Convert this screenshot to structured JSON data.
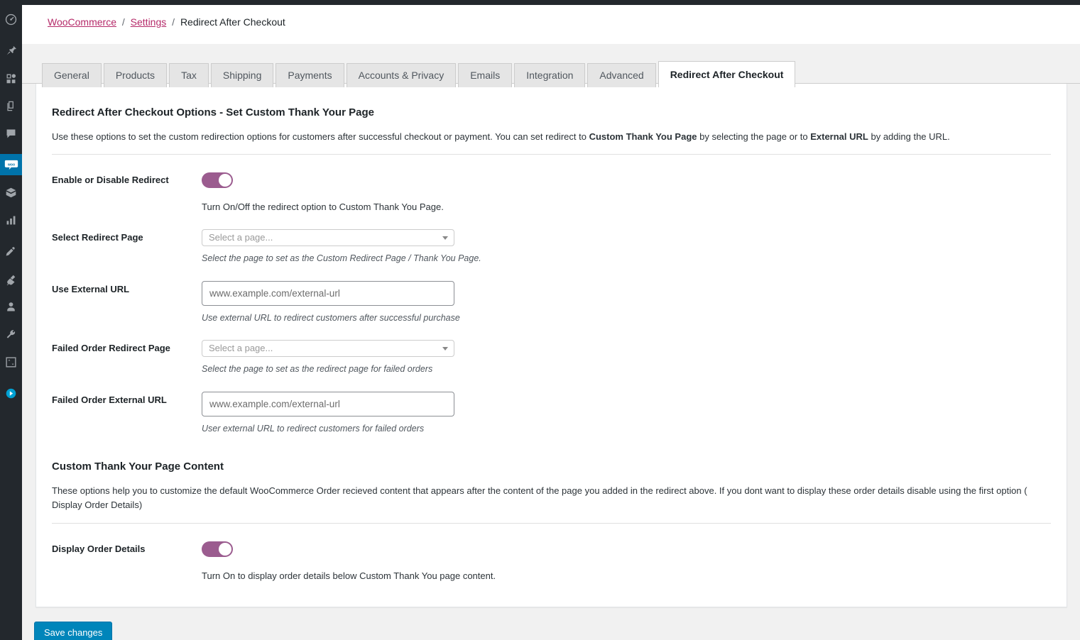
{
  "sidebar": {
    "items": [
      {
        "name": "dashboard",
        "icon": "dashboard-icon",
        "current": false
      },
      {
        "name": "posts",
        "icon": "pin-icon",
        "current": false
      },
      {
        "name": "media",
        "icon": "media-icon",
        "current": false
      },
      {
        "name": "pages",
        "icon": "pages-icon",
        "current": false
      },
      {
        "name": "comments",
        "icon": "comment-icon",
        "current": false
      },
      {
        "name": "woocommerce",
        "icon": "woocommerce-icon",
        "current": true
      },
      {
        "name": "products",
        "icon": "box-icon",
        "current": false
      },
      {
        "name": "analytics",
        "icon": "bar-chart-icon",
        "current": false
      },
      {
        "name": "appearance",
        "icon": "paint-roller-icon",
        "current": false
      },
      {
        "name": "plugins",
        "icon": "plug-icon",
        "current": false
      },
      {
        "name": "users",
        "icon": "user-icon",
        "current": false
      },
      {
        "name": "tools",
        "icon": "wrench-icon",
        "current": false
      },
      {
        "name": "settings",
        "icon": "sliders-icon",
        "current": false
      },
      {
        "name": "media-player",
        "icon": "play-circle-icon",
        "current": false
      }
    ]
  },
  "breadcrumb": {
    "root": "WooCommerce",
    "sep": "/",
    "settings": "Settings",
    "current": "Redirect After Checkout"
  },
  "tabs": [
    {
      "label": "General",
      "active": false
    },
    {
      "label": "Products",
      "active": false
    },
    {
      "label": "Tax",
      "active": false
    },
    {
      "label": "Shipping",
      "active": false
    },
    {
      "label": "Payments",
      "active": false
    },
    {
      "label": "Accounts & Privacy",
      "active": false
    },
    {
      "label": "Emails",
      "active": false
    },
    {
      "label": "Integration",
      "active": false
    },
    {
      "label": "Advanced",
      "active": false
    },
    {
      "label": "Redirect After Checkout",
      "active": true
    }
  ],
  "section_one": {
    "title": "Redirect After Checkout Options - Set Custom Thank Your Page",
    "desc_part1": "Use these options to set the custom redirection options for customers after successful checkout or payment. You can set redirect to ",
    "desc_bold1": "Custom Thank You Page",
    "desc_part2": " by selecting the page or to ",
    "desc_bold2": "External URL",
    "desc_part3": " by adding the URL."
  },
  "rows": {
    "enable_redirect": {
      "label": "Enable or Disable Redirect",
      "toggle_state": "on",
      "help": "Turn On/Off the redirect option to Custom Thank You Page."
    },
    "select_redirect_page": {
      "label": "Select Redirect Page",
      "placeholder": "Select a page...",
      "help": "Select the page to set as the Custom Redirect Page / Thank You Page."
    },
    "use_external_url": {
      "label": "Use External URL",
      "placeholder": "www.example.com/external-url",
      "value": "",
      "help": "Use external URL to redirect customers after successful purchase"
    },
    "failed_order_redirect_page": {
      "label": "Failed Order Redirect Page",
      "placeholder": "Select a page...",
      "help": "Select the page to set as the redirect page for failed orders"
    },
    "failed_order_external_url": {
      "label": "Failed Order External URL",
      "placeholder": "www.example.com/external-url",
      "value": "",
      "help": "User external URL to redirect customers for failed orders"
    },
    "display_order_details": {
      "label": "Display Order Details",
      "toggle_state": "on",
      "help": "Turn On to display order details below Custom Thank You page content."
    }
  },
  "section_two": {
    "title": "Custom Thank Your Page Content",
    "desc": "These options help you to customize the default WooCommerce Order recieved content that appears after the content of the page you added in the redirect above. If you dont want to display these order details disable using the first option ( Display Order Details)"
  },
  "footer": {
    "save_label": "Save changes"
  },
  "colors": {
    "toggle_on": "#9b5c8f",
    "link": "#b52a69",
    "save_button": "#0085ba",
    "admin_menu_bg": "#23282d",
    "current_menu_bg": "#0073aa"
  }
}
